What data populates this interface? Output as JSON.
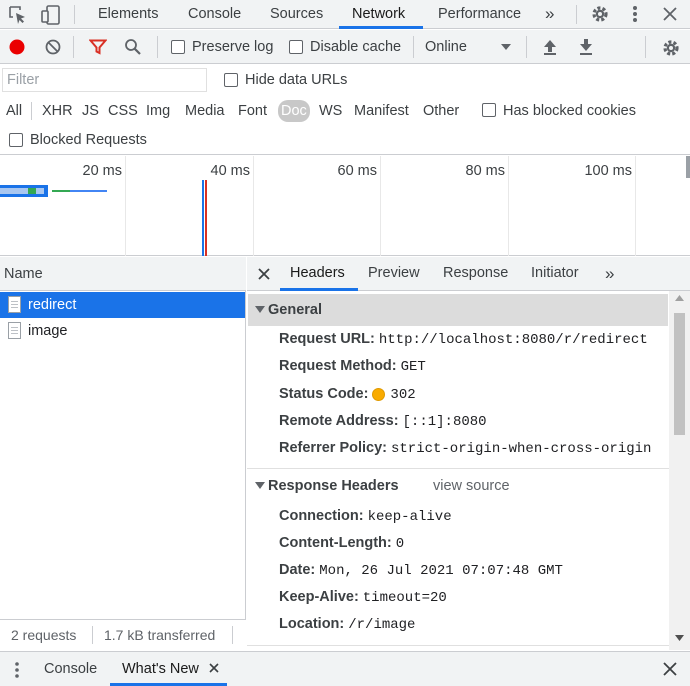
{
  "top_tabs": {
    "elements": "Elements",
    "console": "Console",
    "sources": "Sources",
    "network": "Network",
    "performance": "Performance",
    "more": "»"
  },
  "toolbar": {
    "preserve_log": "Preserve log",
    "disable_cache": "Disable cache",
    "throttle_value": "Online"
  },
  "filter": {
    "placeholder": "Filter",
    "hide_data_urls": "Hide data URLs"
  },
  "types": {
    "all": "All",
    "xhr": "XHR",
    "js": "JS",
    "css": "CSS",
    "img": "Img",
    "media": "Media",
    "font": "Font",
    "doc": "Doc",
    "ws": "WS",
    "manifest": "Manifest",
    "other": "Other",
    "has_blocked_cookies": "Has blocked cookies"
  },
  "blocked_requests": "Blocked Requests",
  "overview": {
    "ticks": [
      "20 ms",
      "40 ms",
      "60 ms",
      "80 ms",
      "100 ms"
    ]
  },
  "requests": {
    "column": "Name",
    "items": [
      "redirect",
      "image"
    ],
    "footer_count": "2 requests",
    "footer_transferred": "1.7 kB transferred"
  },
  "detail": {
    "tabs": {
      "headers": "Headers",
      "preview": "Preview",
      "response": "Response",
      "initiator": "Initiator",
      "more": "»"
    },
    "general": {
      "title": "General",
      "request_url_key": "Request URL:",
      "request_url": "http://localhost:8080/r/redirect",
      "request_method_key": "Request Method:",
      "request_method": "GET",
      "status_code_key": "Status Code:",
      "status_code": "302",
      "remote_address_key": "Remote Address:",
      "remote_address": "[::1]:8080",
      "referrer_policy_key": "Referrer Policy:",
      "referrer_policy": "strict-origin-when-cross-origin"
    },
    "response_headers": {
      "title": "Response Headers",
      "view_source": "view source",
      "connection_key": "Connection:",
      "connection": "keep-alive",
      "content_length_key": "Content-Length:",
      "content_length": "0",
      "date_key": "Date:",
      "date": "Mon, 26 Jul 2021 07:07:48 GMT",
      "keep_alive_key": "Keep-Alive:",
      "keep_alive": "timeout=20",
      "location_key": "Location:",
      "location": "/r/image"
    }
  },
  "drawer": {
    "console": "Console",
    "whats_new": "What's New"
  },
  "colors": {
    "accent": "#1a73e8",
    "record": "#ea0000",
    "filter_active": "#d93025",
    "status_warn": "#f9ab00"
  }
}
